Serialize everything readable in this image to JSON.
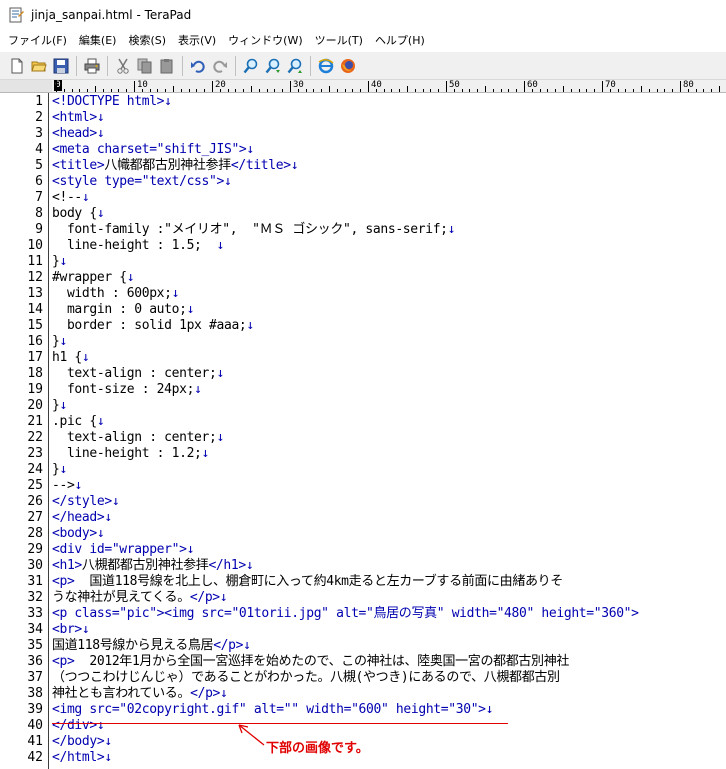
{
  "window": {
    "title": "jinja_sanpai.html - TeraPad"
  },
  "menu": [
    "ファイル(F)",
    "編集(E)",
    "検索(S)",
    "表示(V)",
    "ウィンドウ(W)",
    "ツール(T)",
    "ヘルプ(H)"
  ],
  "toolbar": {
    "icons": [
      "new-file-icon",
      "open-folder-icon",
      "save-icon",
      "print-icon",
      "cut-icon",
      "copy-icon",
      "paste-icon",
      "undo-icon",
      "redo-icon",
      "search-icon",
      "search-next-icon",
      "search-prev-icon",
      "ie-browser-icon",
      "firefox-browser-icon"
    ]
  },
  "ruler": {
    "cursor_col": "0",
    "labels": [
      "10",
      "20",
      "30",
      "40",
      "50",
      "60",
      "70",
      "80"
    ]
  },
  "editor": {
    "line_numbers": [
      "1",
      "2",
      "3",
      "4",
      "5",
      "6",
      "7",
      "8",
      "9",
      "10",
      "11",
      "12",
      "13",
      "14",
      "15",
      "16",
      "17",
      "18",
      "19",
      "20",
      "21",
      "22",
      "23",
      "24",
      "25",
      "26",
      "27",
      "28",
      "29",
      "30",
      "31",
      "32",
      "33",
      "34",
      "35",
      "36",
      "37",
      "38",
      "39",
      "40",
      "41",
      "42"
    ],
    "lines": [
      "<!DOCTYPE html>↓",
      "<html>↓",
      "<head>↓",
      "<meta charset=\"shift_JIS\">↓",
      "<title>八幟都都古別神社参拝</title>↓",
      "<style type=\"text/css\">↓",
      "<!--↓",
      "body {↓",
      "  font-family :\"メイリオ\",  \"ＭＳ ゴシック\", sans-serif;↓",
      "  line-height : 1.5;  ↓",
      "}↓",
      "#wrapper {↓",
      "  width : 600px;↓",
      "  margin : 0 auto;↓",
      "  border : solid 1px #aaa;↓",
      "}↓",
      "h1 {↓",
      "  text-align : center;↓",
      "  font-size : 24px;↓",
      "}↓",
      ".pic {↓",
      "  text-align : center;↓",
      "  line-height : 1.2;↓",
      "}↓",
      "-->↓",
      "</style>↓",
      "</head>↓",
      "<body>↓",
      "<div id=\"wrapper\">↓",
      "<h1>八槻都都古別神社参拝</h1>↓",
      "<p>  国道118号線を北上し、棚倉町に入って約4km走ると左カーブする前面に由緒ありそ",
      "うな神社が見えてくる。</p>↓",
      "<p class=\"pic\"><img src=\"01torii.jpg\" alt=\"鳥居の写真\" width=\"480\" height=\"360\">",
      "<br>↓",
      "国道118号線から見える鳥居</p>↓",
      "<p>  2012年1月から全国一宮巡拝を始めたので、この神社は、陸奥国一宮の都都古別神社",
      "（つつこわけじんじゃ）であることがわかった。八槻(やつき)にあるので、八槻都都古別",
      "神社とも言われている。</p>↓",
      "<img src=\"02copyright.gif\" alt=\"\" width=\"600\" height=\"30\">↓",
      "</div>↓",
      "</body>↓",
      "</html>↓"
    ]
  },
  "annotation": {
    "text": "下部の画像です。",
    "color": "#e00000"
  }
}
